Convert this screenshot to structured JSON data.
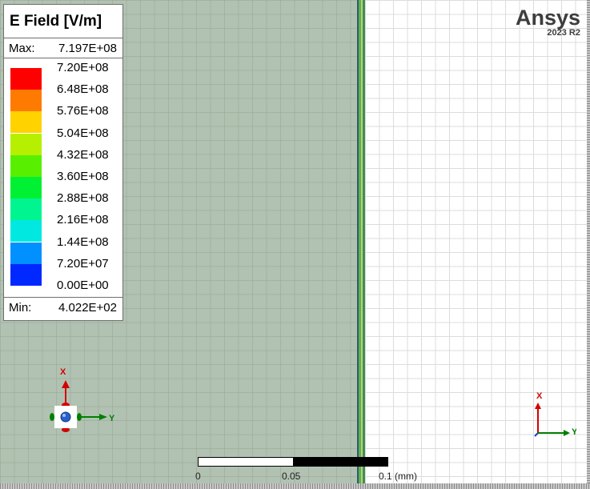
{
  "legend": {
    "title": "E Field [V/m]",
    "max_label": "Max:",
    "max_value": "7.197E+08",
    "min_label": "Min:",
    "min_value": "4.022E+02",
    "levels": [
      {
        "label": "7.20E+08",
        "color": "#ff0000"
      },
      {
        "label": "6.48E+08",
        "color": "#ff7a00"
      },
      {
        "label": "5.76E+08",
        "color": "#ffd200"
      },
      {
        "label": "5.04E+08",
        "color": "#b6f000"
      },
      {
        "label": "4.32E+08",
        "color": "#58f000"
      },
      {
        "label": "3.60E+08",
        "color": "#00f034"
      },
      {
        "label": "2.88E+08",
        "color": "#00f590"
      },
      {
        "label": "2.16E+08",
        "color": "#00e8e0"
      },
      {
        "label": "1.44E+08",
        "color": "#0090ff"
      },
      {
        "label": "7.20E+07",
        "color": "#0028ff"
      },
      {
        "label": "0.00E+00",
        "color": "#0000e6"
      }
    ]
  },
  "brand": {
    "name": "Ansys",
    "version": "2023 R2"
  },
  "scale_bar": {
    "labels": [
      "0",
      "0.05",
      "0.1 (mm)"
    ]
  },
  "triad_left": {
    "x_label": "X",
    "y_label": "Y"
  },
  "triad_right": {
    "x_label": "X",
    "y_label": "Y"
  },
  "colors": {
    "mesh_region": "#b2c2b2",
    "axis_x": "#d40000",
    "axis_y": "#008000"
  }
}
